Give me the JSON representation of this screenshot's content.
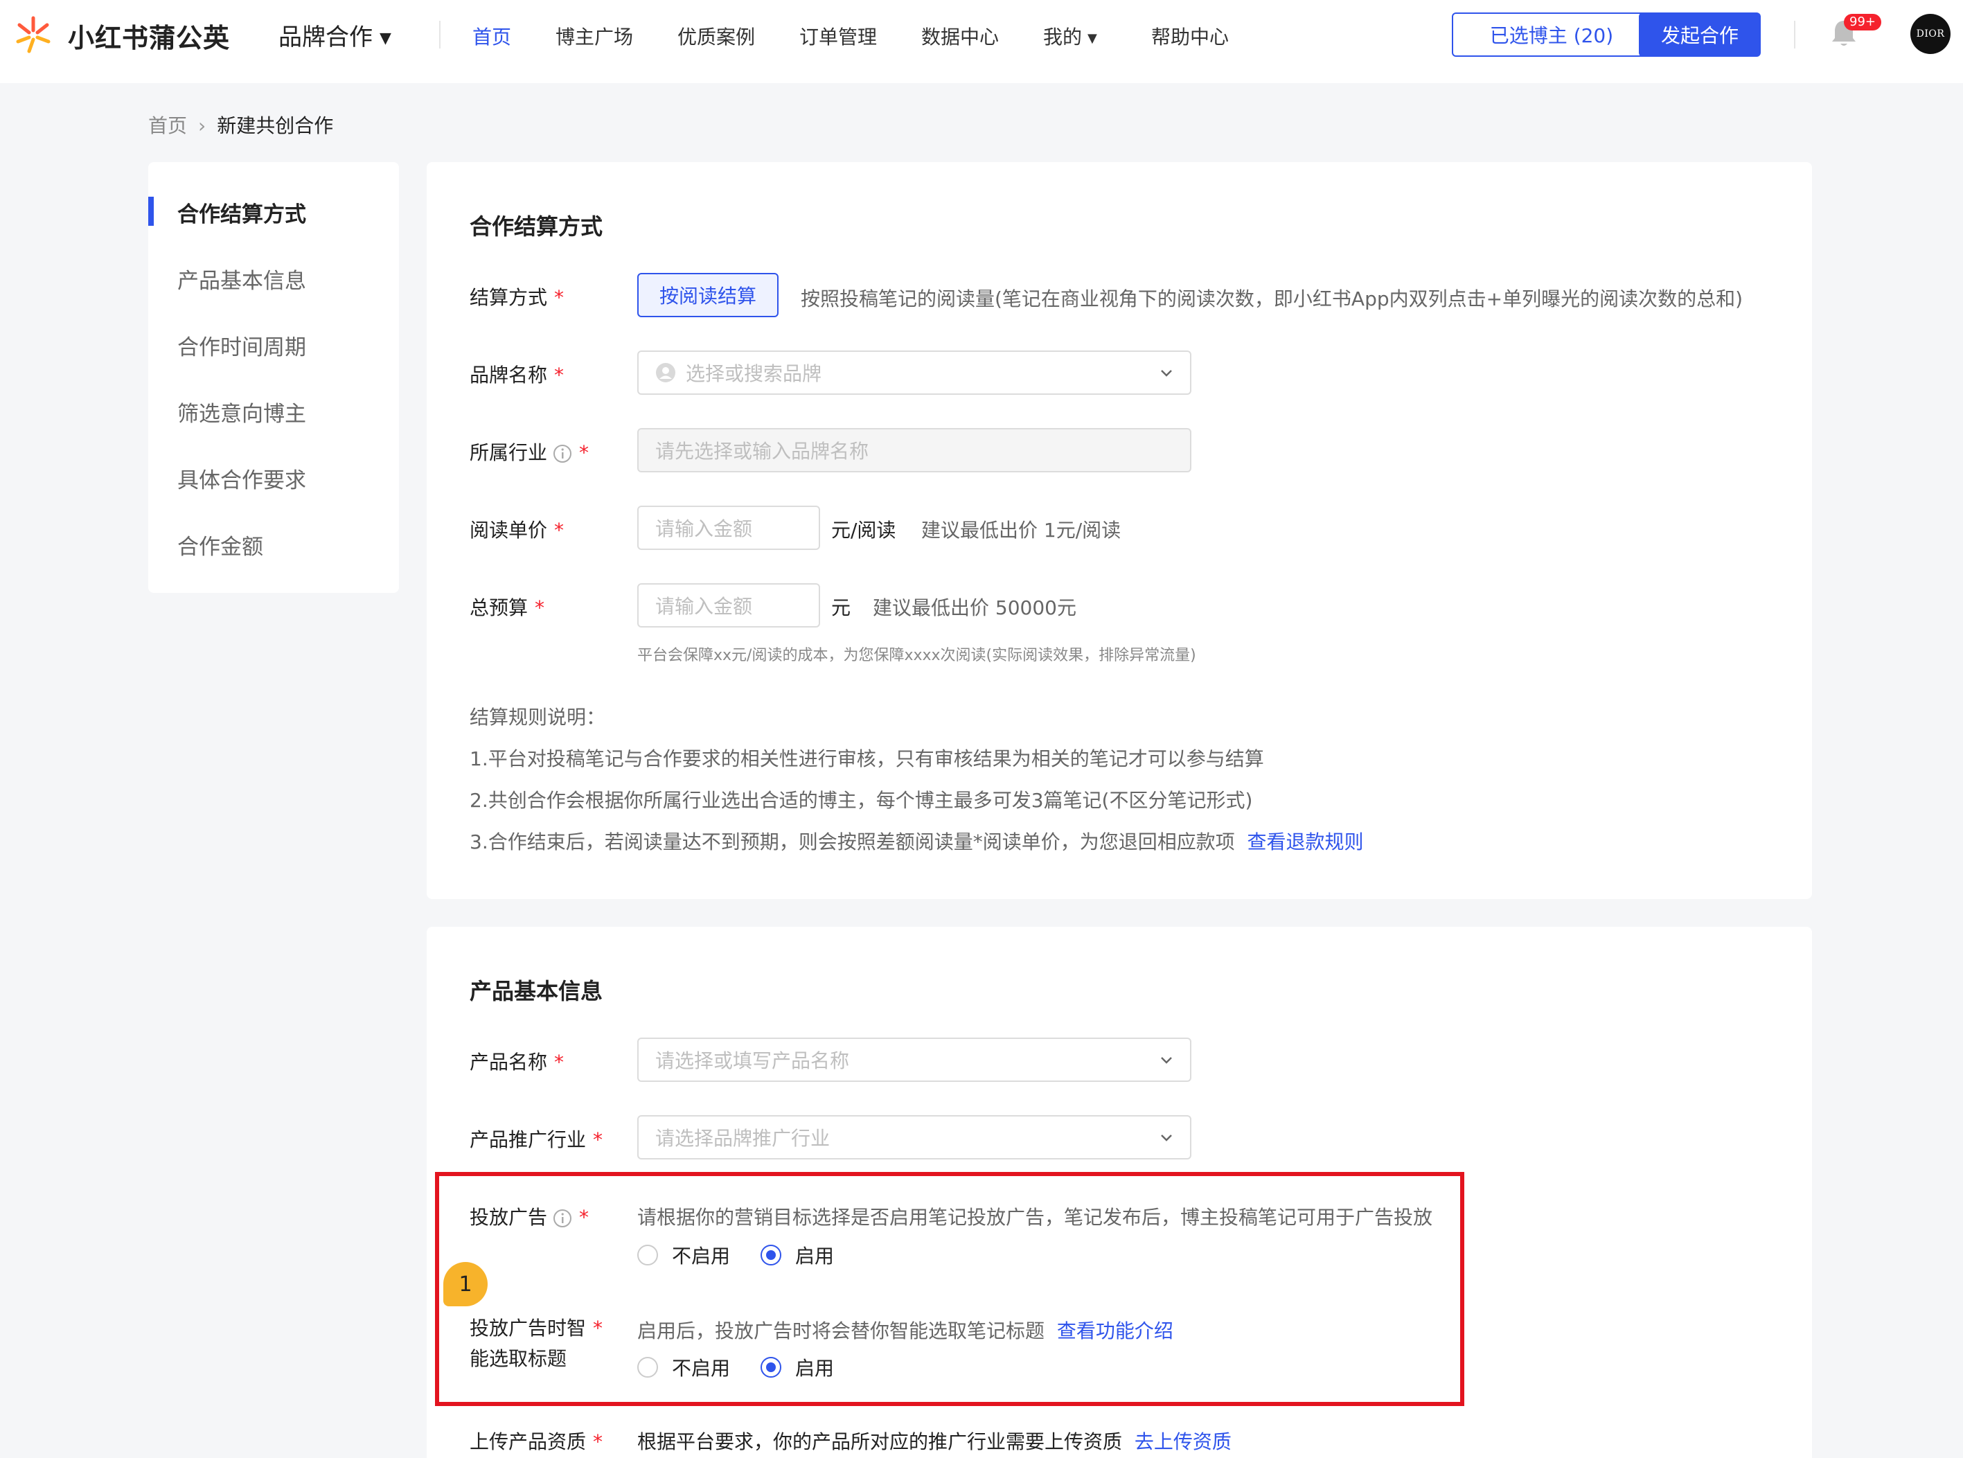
{
  "topbar": {
    "brand_name": "小红书蒲公英",
    "brand_menu": "品牌合作",
    "nav": [
      "首页",
      "博主广场",
      "优质案例",
      "订单管理",
      "数据中心",
      "我的",
      "帮助中心"
    ],
    "selected_btn": "已选博主 (20)",
    "start_btn": "发起合作",
    "badge": "99+",
    "avatar_text": "DIOR"
  },
  "breadcrumb": {
    "home": "首页",
    "current": "新建共创合作"
  },
  "sidebar": {
    "items": [
      "合作结算方式",
      "产品基本信息",
      "合作时间周期",
      "筛选意向博主",
      "具体合作要求",
      "合作金额"
    ]
  },
  "settlement": {
    "title": "合作结算方式",
    "method_label": "结算方式",
    "method_btn": "按阅读结算",
    "method_hint": "按照投稿笔记的阅读量(笔记在商业视角下的阅读次数，即小红书App内双列点击+单列曝光的阅读次数的总和)",
    "brand_label": "品牌名称",
    "brand_placeholder": "选择或搜索品牌",
    "industry_label": "所属行业",
    "industry_placeholder": "请先选择或输入品牌名称",
    "price_label": "阅读单价",
    "price_placeholder": "请输入金额",
    "price_unit": "元/阅读",
    "price_hint": "建议最低出价 1元/阅读",
    "budget_label": "总预算",
    "budget_placeholder": "请输入金额",
    "budget_unit": "元",
    "budget_hint": "建议最低出价 50000元",
    "budget_note": "平台会保障xx元/阅读的成本，为您保障xxxx次阅读(实际阅读效果，排除异常流量)",
    "rules_title": "结算规则说明：",
    "rule1": "1.平台对投稿笔记与合作要求的相关性进行审核，只有审核结果为相关的笔记才可以参与结算",
    "rule2": "2.共创合作会根据你所属行业选出合适的博主，每个博主最多可发3篇笔记(不区分笔记形式)",
    "rule3": "3.合作结束后，若阅读量达不到预期，则会按照差额阅读量*阅读单价，为您退回相应款项",
    "rule3_link": "查看退款规则"
  },
  "product": {
    "title": "产品基本信息",
    "name_label": "产品名称",
    "name_placeholder": "请选择或填写产品名称",
    "promo_label": "产品推广行业",
    "promo_placeholder": "请选择品牌推广行业",
    "ad_label": "投放广告",
    "ad_hint": "请根据你的营销目标选择是否启用笔记投放广告，笔记发布后，博主投稿笔记可用于广告投放",
    "ad_off": "不启用",
    "ad_on": "启用",
    "smart_label_1": "投放广告时智",
    "smart_label_2": "能选取标题",
    "smart_hint": "启用后，投放广告时将会替你智能选取笔记标题",
    "smart_link": "查看功能介绍",
    "smart_off": "不启用",
    "smart_on": "启用",
    "upload_label": "上传产品资质",
    "upload_hint": "根据平台要求，你的产品所对应的推广行业需要上传资质",
    "upload_link": "去上传资质"
  },
  "annotation": {
    "step": "1"
  },
  "colors": {
    "accent": "#2f54eb",
    "required": "#f5222d",
    "highlight": "#e3141f",
    "step_badge": "#f7b32b"
  }
}
